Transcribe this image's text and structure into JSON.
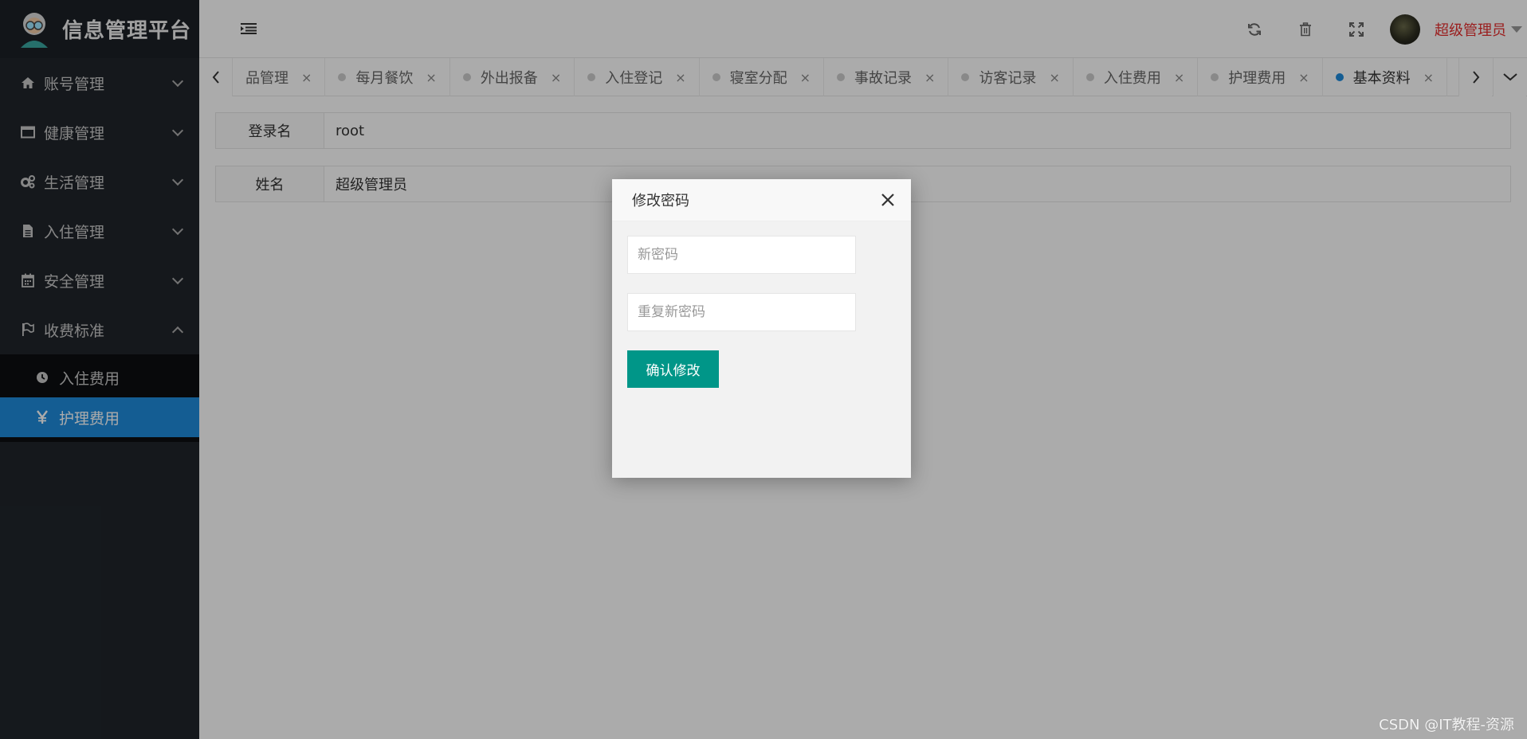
{
  "app": {
    "title": "信息管理平台"
  },
  "sidebar": {
    "items": [
      {
        "label": "账号管理",
        "icon": "home-icon"
      },
      {
        "label": "健康管理",
        "icon": "window-icon"
      },
      {
        "label": "生活管理",
        "icon": "gears-icon"
      },
      {
        "label": "入住管理",
        "icon": "file-icon"
      },
      {
        "label": "安全管理",
        "icon": "calendar-icon"
      },
      {
        "label": "收费标准",
        "icon": "flag-icon",
        "expanded": true
      }
    ],
    "subitems": [
      {
        "label": "入住费用",
        "icon": "clock-icon",
        "active": false
      },
      {
        "label": "护理费用",
        "icon": "yen-icon",
        "active": true
      }
    ]
  },
  "header": {
    "user_name": "超级管理员",
    "icons": [
      "refresh-icon",
      "trash-icon",
      "fullscreen-icon"
    ]
  },
  "tabs": [
    {
      "label": "品管理",
      "close": "×"
    },
    {
      "label": "每月餐饮",
      "close": "×"
    },
    {
      "label": "外出报备",
      "close": "×"
    },
    {
      "label": "入住登记",
      "close": "×"
    },
    {
      "label": "寝室分配",
      "close": "×"
    },
    {
      "label": "事故记录",
      "close": "×"
    },
    {
      "label": "访客记录",
      "close": "×"
    },
    {
      "label": "入住费用",
      "close": "×"
    },
    {
      "label": "护理费用",
      "close": "×"
    },
    {
      "label": "基本资料",
      "close": "×",
      "active": true
    }
  ],
  "profile": {
    "login_label": "登录名",
    "login_value": "root",
    "name_label": "姓名",
    "name_value": "超级管理员"
  },
  "modal": {
    "title": "修改密码",
    "new_password_placeholder": "新密码",
    "repeat_password_placeholder": "重复新密码",
    "confirm_label": "确认修改"
  },
  "watermark": "CSDN @IT教程-资源",
  "colors": {
    "accent": "#1e8bdc",
    "button": "#009688",
    "sidebar": "#20252b",
    "user_name": "#e62e2e"
  }
}
